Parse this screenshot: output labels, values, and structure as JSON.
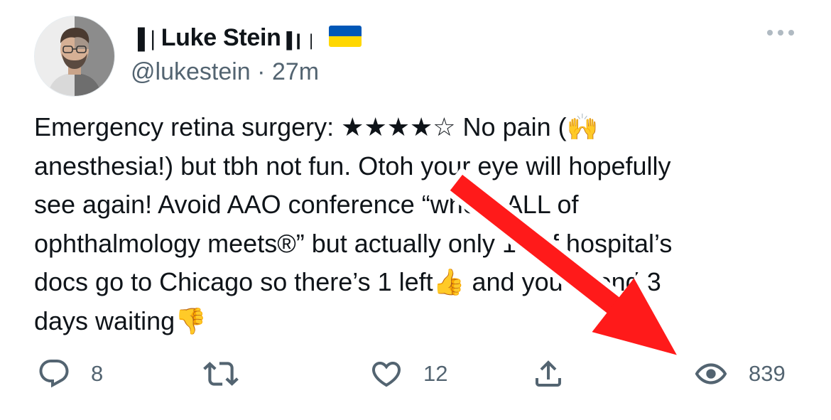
{
  "tweet": {
    "author": {
      "display_name": "▍▋▌╸Luke Stein█▐┃│▐",
      "name_text": "Luke Stein",
      "prefix_glyph": "▐❘",
      "suffix_glyph": "▐❙❘",
      "handle": "@lukestein",
      "separator": "·",
      "time": "27m",
      "flag_icon": "ukraine-flag",
      "flag_colors": {
        "top": "#0057b7",
        "bottom": "#ffd700"
      },
      "avatar_icon": "avatar-photo"
    },
    "more_icon": "more-dots-icon",
    "text_lines": [
      "Emergency retina surgery: ★★★★☆ No pain (🙌",
      "anesthesia!) but tbh not fun. Otoh your eye will hopefully",
      "see again! Avoid AAO conference “where ALL of",
      "ophthalmology meets®” but actually only 19 of hospital’s",
      "docs go to Chicago so there’s 1 left👍 and you spend 3",
      "days waiting👎"
    ],
    "actions": {
      "reply": {
        "icon": "reply-icon",
        "count": "8"
      },
      "retweet": {
        "icon": "retweet-icon",
        "count": ""
      },
      "like": {
        "icon": "heart-icon",
        "count": "12"
      },
      "share": {
        "icon": "share-icon",
        "count": ""
      },
      "views": {
        "icon": "eye-icon",
        "count": "839"
      }
    }
  },
  "annotation": {
    "icon": "red-arrow-pointing-to-views",
    "color": "#ff0000"
  }
}
